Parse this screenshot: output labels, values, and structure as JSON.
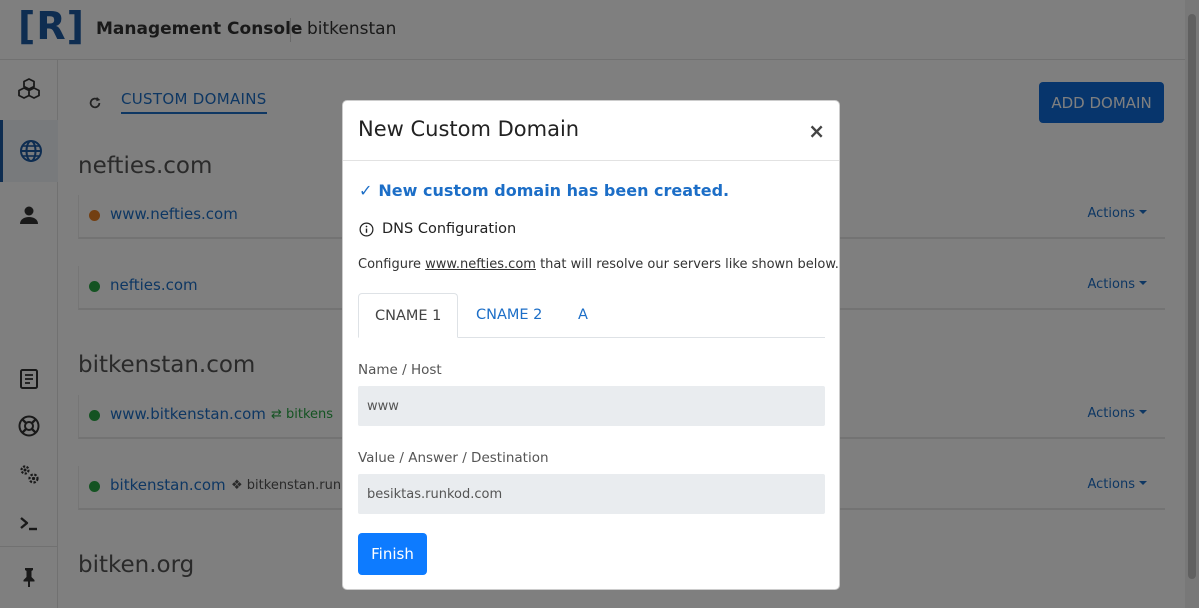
{
  "header": {
    "logo": "[R]",
    "app_title": "Management Console",
    "workspace": "bitkenstan"
  },
  "sidebar": {
    "items": [
      {
        "icon": "cubes-icon"
      },
      {
        "icon": "globe-icon",
        "active": true
      },
      {
        "icon": "user-icon"
      },
      {
        "icon": "document-icon"
      },
      {
        "icon": "lifebuoy-icon"
      },
      {
        "icon": "gears-icon"
      },
      {
        "icon": "terminal-icon"
      },
      {
        "icon": "pin-icon"
      }
    ]
  },
  "main": {
    "section_tab": "CUSTOM DOMAINS",
    "add_domain_label": "ADD DOMAIN",
    "groups": [
      {
        "title": "nefties.com",
        "rows": [
          {
            "status": "orange",
            "domain": "www.nefties.com",
            "meta": "",
            "actions": "Actions"
          },
          {
            "status": "green",
            "domain": "nefties.com",
            "meta": "",
            "actions": "Actions"
          }
        ]
      },
      {
        "title": "bitkenstan.com",
        "rows": [
          {
            "status": "green",
            "domain": "www.bitkenstan.com",
            "meta": "bitkens",
            "actions": "Actions"
          },
          {
            "status": "green",
            "domain": "bitkenstan.com",
            "meta": "bitkenstan.run",
            "actions": "Actions"
          }
        ]
      },
      {
        "title": "bitken.org",
        "rows": []
      }
    ]
  },
  "modal": {
    "title": "New Custom Domain",
    "close_label": "×",
    "success_message": "New custom domain has been created.",
    "dns_heading": "DNS Configuration",
    "instruction_prefix": "Configure ",
    "instruction_domain": "www.nefties.com",
    "instruction_suffix": " that will resolve our servers like shown below.",
    "tabs": [
      {
        "label": "CNAME 1",
        "active": true
      },
      {
        "label": "CNAME 2",
        "active": false
      },
      {
        "label": "A",
        "active": false
      }
    ],
    "name_label": "Name / Host",
    "name_value": "www",
    "value_label": "Value / Answer / Destination",
    "value_value": "besiktas.runkod.com",
    "finish_label": "Finish"
  },
  "colors": {
    "brand": "#1c5aa3",
    "link": "#1c6ec7",
    "primary_button": "#0d7bff",
    "status_orange": "#e67e22",
    "status_green": "#28a745"
  }
}
